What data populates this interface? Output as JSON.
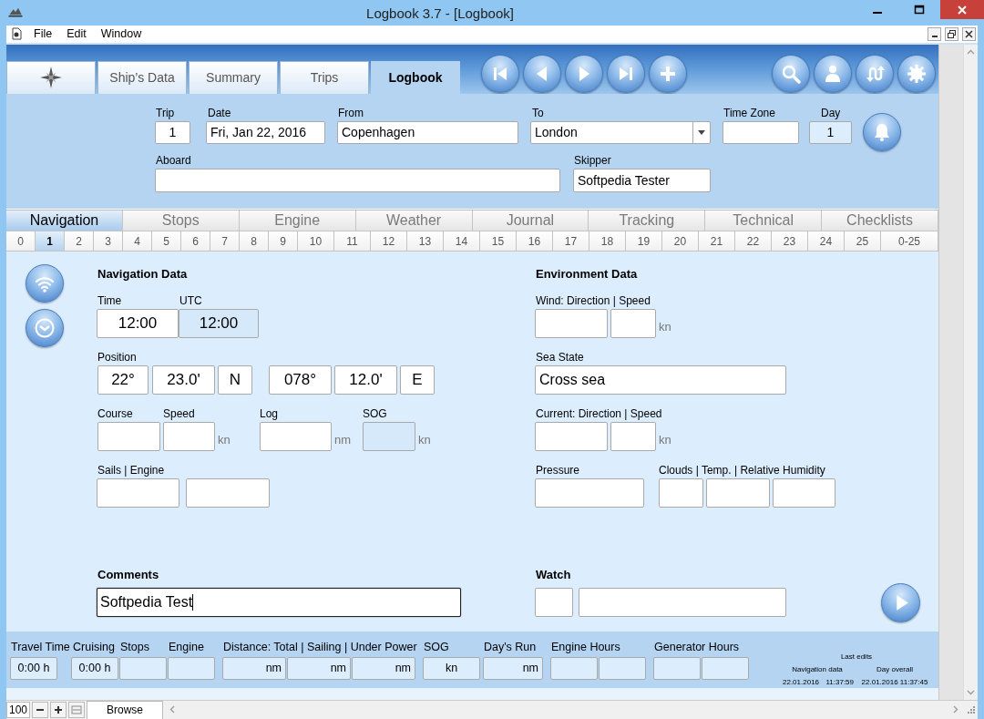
{
  "window": {
    "title": "Logbook 3.7 - [Logbook]"
  },
  "menu": [
    "File",
    "Edit",
    "Window"
  ],
  "tabs": [
    {
      "kind": "compass",
      "selected": false
    },
    {
      "kind": "text",
      "label": "Ship’s Data",
      "selected": false
    },
    {
      "kind": "text",
      "label": "Summary",
      "selected": false
    },
    {
      "kind": "text",
      "label": "Trips",
      "selected": false
    },
    {
      "kind": "text",
      "label": "Logbook",
      "selected": true
    }
  ],
  "header": {
    "rows": [
      [
        {
          "label": "Trip",
          "value": "1",
          "kind": "text"
        },
        {
          "label": "Date",
          "value": "Fri, Jan 22, 2016",
          "kind": "text"
        },
        {
          "label": "From",
          "value": "Copenhagen",
          "kind": "text"
        },
        {
          "label": "To",
          "value": "London",
          "kind": "dropdown"
        },
        {
          "label": "Time Zone",
          "kind": "text"
        },
        {
          "label": "Day",
          "value": "1",
          "kind": "readonly"
        }
      ],
      [
        {
          "label": "Aboard",
          "kind": "text"
        },
        {
          "label": "Skipper",
          "value": "Softpedia Tester",
          "kind": "text"
        }
      ]
    ]
  },
  "sections": [
    {
      "label": "Navigation",
      "selected": true
    },
    {
      "label": "Stops",
      "selected": false
    },
    {
      "label": "Engine",
      "selected": false
    },
    {
      "label": "Weather",
      "selected": false
    },
    {
      "label": "Journal",
      "selected": false
    },
    {
      "label": "Tracking",
      "selected": false
    },
    {
      "label": "Technical",
      "selected": false
    },
    {
      "label": "Checklists",
      "selected": false
    }
  ],
  "days": [
    {
      "label": "0",
      "selected": false
    },
    {
      "label": "1",
      "selected": true
    },
    {
      "label": "2",
      "selected": false
    },
    {
      "label": "3",
      "selected": false
    },
    {
      "label": "4",
      "selected": false
    },
    {
      "label": "5",
      "selected": false
    },
    {
      "label": "6",
      "selected": false
    },
    {
      "label": "7",
      "selected": false
    },
    {
      "label": "8",
      "selected": false
    },
    {
      "label": "9",
      "selected": false
    },
    {
      "label": "10",
      "selected": false
    },
    {
      "label": "11",
      "selected": false
    },
    {
      "label": "12",
      "selected": false
    },
    {
      "label": "13",
      "selected": false
    },
    {
      "label": "14",
      "selected": false
    },
    {
      "label": "15",
      "selected": false
    },
    {
      "label": "16",
      "selected": false
    },
    {
      "label": "17",
      "selected": false
    },
    {
      "label": "18",
      "selected": false
    },
    {
      "label": "19",
      "selected": false
    },
    {
      "label": "20",
      "selected": false
    },
    {
      "label": "21",
      "selected": false
    },
    {
      "label": "22",
      "selected": false
    },
    {
      "label": "23",
      "selected": false
    },
    {
      "label": "24",
      "selected": false
    },
    {
      "label": "25",
      "selected": false
    },
    {
      "label": "0-25",
      "selected": false
    }
  ],
  "navigation": {
    "title": "Navigation Data",
    "groups": [
      {
        "labels": [
          "Time",
          "UTC"
        ],
        "fields": [
          {
            "value": "12:00",
            "disabled": false
          },
          {
            "value": "12:00",
            "disabled": true
          }
        ]
      },
      {
        "labels": [
          "Position"
        ],
        "fields": [
          {
            "value": "22°",
            "disabled": false
          },
          {
            "value": "23.0'",
            "disabled": false
          },
          {
            "value": "N",
            "disabled": false
          },
          {
            "value": "078°",
            "disabled": false
          },
          {
            "value": "12.0'",
            "disabled": false
          },
          {
            "value": "E",
            "disabled": false
          }
        ]
      },
      {
        "labels": [
          "Course",
          "Speed",
          "Log",
          "SOG"
        ],
        "fields": [
          {
            "disabled": false
          },
          {
            "disabled": false,
            "unit": "kn"
          },
          {
            "disabled": false,
            "unit": "nm"
          },
          {
            "disabled": true,
            "unit": "kn"
          }
        ]
      },
      {
        "labels": [
          "Sails | Engine"
        ],
        "fields": [
          {
            "disabled": false
          },
          {
            "disabled": false
          }
        ]
      }
    ]
  },
  "environment": {
    "title": "Environment Data",
    "groups": [
      {
        "labels": [
          "Wind: Direction | Speed"
        ],
        "fields": [
          {
            "disabled": false
          },
          {
            "disabled": false,
            "unit": "kn"
          }
        ]
      },
      {
        "labels": [
          "Sea State"
        ],
        "fields": [
          {
            "value": "Cross sea",
            "disabled": false
          }
        ]
      },
      {
        "labels": [
          "Current: Direction | Speed"
        ],
        "fields": [
          {
            "disabled": false
          },
          {
            "disabled": false,
            "unit": "kn"
          }
        ]
      },
      {
        "labels": [
          "Pressure",
          "Clouds | Temp. | Relative Humidity"
        ],
        "fields": [
          {
            "disabled": false
          },
          {
            "disabled": false
          },
          {
            "disabled": false
          },
          {
            "disabled": false
          }
        ]
      }
    ]
  },
  "comments": {
    "title": "Comments",
    "value": "Softpedia Test",
    "focused": true
  },
  "watch": {
    "title": "Watch",
    "fields": [
      {
        "disabled": false
      },
      {
        "disabled": false
      }
    ]
  },
  "summary": {
    "labels": [
      "Travel Time",
      "Cruising",
      "Stops",
      "Engine",
      "Distance: Total | Sailing | Under Power",
      "SOG",
      "Day's Run",
      "Engine Hours",
      "Generator Hours"
    ],
    "fields": [
      {
        "kind": "time",
        "text": "0:00 h"
      },
      {
        "kind": "time",
        "text": "0:00 h"
      },
      {
        "kind": "blank"
      },
      {
        "kind": "blank"
      },
      {
        "kind": "distance",
        "text": "nm"
      },
      {
        "kind": "distance",
        "text": "nm"
      },
      {
        "kind": "distance",
        "text": "nm"
      },
      {
        "kind": "speed",
        "text": "kn"
      },
      {
        "kind": "distance",
        "text": "nm"
      },
      {
        "kind": "blank"
      },
      {
        "kind": "blank"
      },
      {
        "kind": "blank"
      },
      {
        "kind": "blank"
      }
    ]
  },
  "last_edits": {
    "title": "Last edits",
    "columns": [
      "Navigation data",
      "Day overall"
    ],
    "navigation_date": "22.01.2016",
    "navigation_time": "11:37:59",
    "day_overall": "22.01.2016 11:37:45"
  },
  "status_bar": {
    "zoom": "100",
    "mode": "Browse"
  }
}
